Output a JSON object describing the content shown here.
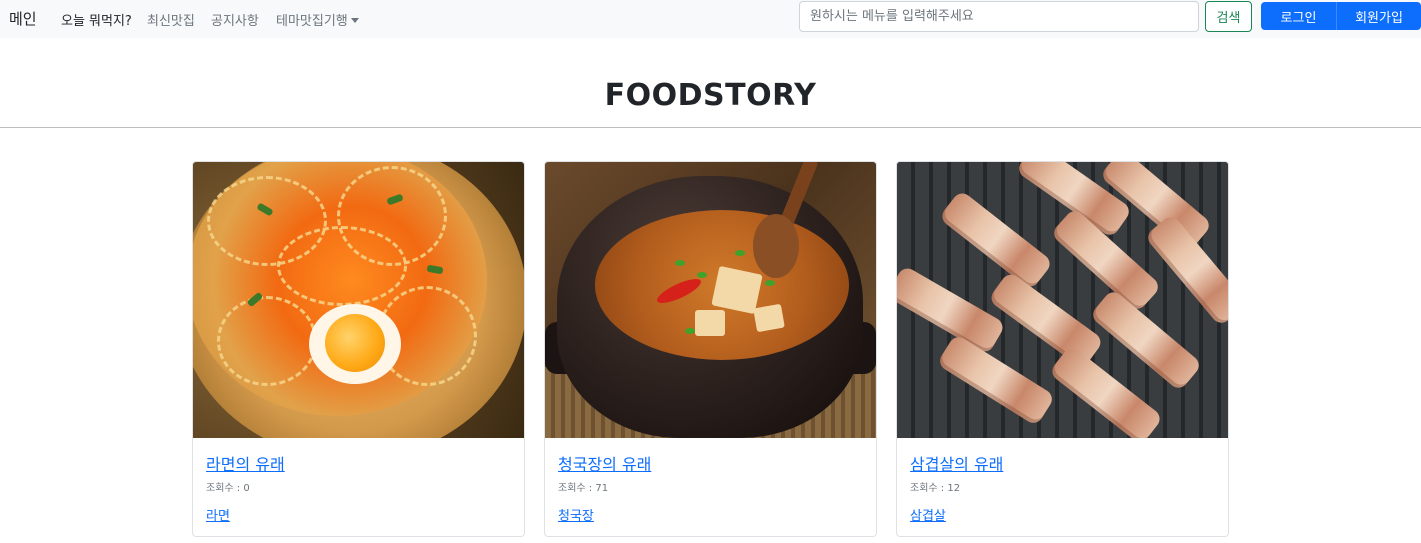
{
  "navbar": {
    "brand": "메인",
    "items": [
      {
        "label": "오늘 뭐먹지?",
        "active": true
      },
      {
        "label": "최신맛집",
        "active": false
      },
      {
        "label": "공지사항",
        "active": false
      },
      {
        "label": "테마맛집기행",
        "active": false,
        "dropdown": true
      }
    ],
    "search": {
      "placeholder": "원하시는 메뉴를 입력해주세요",
      "value": ""
    },
    "search_button": "검색",
    "login_button": "로그인",
    "signup_button": "회원가입"
  },
  "header": {
    "title": "FOODSTORY"
  },
  "cards": [
    {
      "title": "라면의 유래",
      "views": "조회수 : 0",
      "tag": "라면",
      "image": "ramen-photo"
    },
    {
      "title": "청국장의 유래",
      "views": "조회수 : 71",
      "tag": "청국장",
      "image": "cheonggukjang-photo"
    },
    {
      "title": "삼겹살의 유래",
      "views": "조회수 : 12",
      "tag": "삼겹살",
      "image": "samgyeopsal-photo"
    }
  ],
  "colors": {
    "navbar_bg": "#f8f9fa",
    "primary": "#0d6efd",
    "success": "#198754",
    "text": "#212529",
    "muted": "#6c757d"
  }
}
